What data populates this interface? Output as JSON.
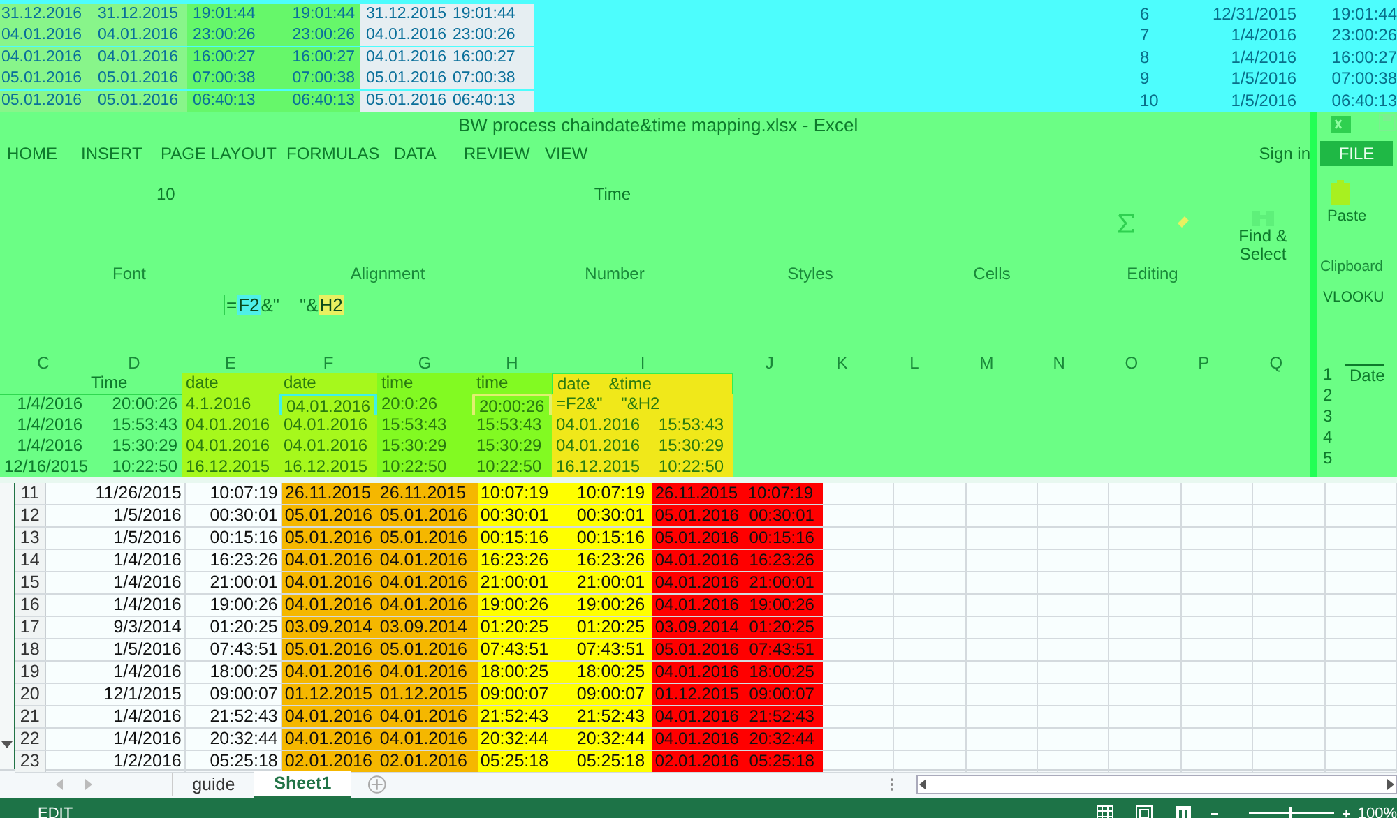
{
  "top_fragment": {
    "rows": [
      [
        "31.12.2016",
        "31.12.2015",
        "19:01:44",
        "19:01:44",
        "31.12.2015",
        "19:01:44"
      ],
      [
        "04.01.2016",
        "04.01.2016",
        "23:00:26",
        "23:00:26",
        "04.01.2016",
        "23:00:26"
      ],
      [
        "04.01.2016",
        "04.01.2016",
        "16:00:27",
        "16:00:27",
        "04.01.2016",
        "16:00:27"
      ],
      [
        "05.01.2016",
        "05.01.2016",
        "07:00:38",
        "07:00:38",
        "05.01.2016",
        "07:00:38"
      ],
      [
        "05.01.2016",
        "05.01.2016",
        "06:40:13",
        "06:40:13",
        "05.01.2016",
        "06:40:13"
      ]
    ]
  },
  "right_fragment": {
    "rows": [
      {
        "row": "6",
        "date": "12/31/2015",
        "time": "19:01:44"
      },
      {
        "row": "7",
        "date": "1/4/2016",
        "time": "23:00:26"
      },
      {
        "row": "8",
        "date": "1/4/2016",
        "time": "16:00:27"
      },
      {
        "row": "9",
        "date": "1/5/2016",
        "time": "07:00:38"
      },
      {
        "row": "10",
        "date": "1/5/2016",
        "time": "06:40:13"
      }
    ]
  },
  "window": {
    "title": "BW process chaindate&time mapping.xlsx - Excel"
  },
  "ribbon": {
    "tabs": [
      {
        "label": "HOME",
        "selected": false
      },
      {
        "label": "INSERT",
        "selected": false
      },
      {
        "label": "PAGE LAYOUT",
        "selected": false
      },
      {
        "label": "FORMULAS",
        "selected": false
      },
      {
        "label": "DATA",
        "selected": false
      },
      {
        "label": "REVIEW",
        "selected": false
      },
      {
        "label": "VIEW",
        "selected": false
      }
    ],
    "sign_in": "Sign in",
    "font_size": "10",
    "number_format": "Time",
    "find_select": "Find & Select",
    "group_labels": [
      "Font",
      "Alignment",
      "Number",
      "Styles",
      "Cells",
      "Editing"
    ]
  },
  "formula_bar": {
    "parts": [
      {
        "text": "=",
        "kind": "plain"
      },
      {
        "text": "F2",
        "kind": "ref",
        "color": "#4ff0e8"
      },
      {
        "text": "&\"    \"&",
        "kind": "plain"
      },
      {
        "text": "H2",
        "kind": "ref",
        "color": "#e8f060"
      }
    ]
  },
  "sheet": {
    "columns": [
      "C",
      "D",
      "E",
      "F",
      "G",
      "H",
      "I",
      "J",
      "K",
      "L",
      "M",
      "N",
      "O",
      "P",
      "Q"
    ],
    "rows": [
      [
        "",
        "Time",
        "date",
        "date",
        "time",
        "time",
        "date &time"
      ],
      [
        "1/4/2016",
        "20:00:26",
        "4.1.2016",
        {
          "text": "04.01.2016",
          "color": "#40f0e8"
        },
        "20:0:26",
        {
          "text": "20:00:26",
          "color": "#e0f070"
        },
        "=F2&\"    \"&H2"
      ],
      [
        "1/4/2016",
        "15:53:43",
        "04.01.2016",
        "04.01.2016",
        "15:53:43",
        "15:53:43",
        "04.01.2016 15:53:43"
      ],
      [
        "1/4/2016",
        "15:30:29",
        "04.01.2016",
        "04.01.2016",
        "15:30:29",
        "15:30:29",
        "04.01.2016 15:30:29"
      ],
      [
        "12/16/2015",
        "10:22:50",
        "16.12.2015",
        "16.12.2015",
        "10:22:50",
        "10:22:50",
        "16.12.2015 10:22:50"
      ]
    ]
  },
  "side_panel": {
    "file_tab": "FILE",
    "paste": "Paste",
    "clipboard": "Clipboard",
    "name_box": "VLOOKU",
    "rows": [
      {
        "row": "1",
        "value": "Date"
      },
      {
        "row": "2"
      },
      {
        "row": "3"
      },
      {
        "row": "4"
      },
      {
        "row": "5"
      }
    ]
  },
  "lower_sheet": {
    "rows": [
      {
        "row": "11",
        "cells": [
          "11/26/2015",
          "10:07:19",
          "26.11.2015",
          "26.11.2015",
          "10:07:19",
          "10:07:19",
          "26.11.2015 10:07:19"
        ]
      },
      {
        "row": "12",
        "cells": [
          "1/5/2016",
          "00:30:01",
          "05.01.2016",
          "05.01.2016",
          "00:30:01",
          "00:30:01",
          "05.01.2016 00:30:01"
        ]
      },
      {
        "row": "13",
        "cells": [
          "1/5/2016",
          "00:15:16",
          "05.01.2016",
          "05.01.2016",
          "00:15:16",
          "00:15:16",
          "05.01.2016 00:15:16"
        ]
      },
      {
        "row": "14",
        "cells": [
          "1/4/2016",
          "16:23:26",
          "04.01.2016",
          "04.01.2016",
          "16:23:26",
          "16:23:26",
          "04.01.2016 16:23:26"
        ]
      },
      {
        "row": "15",
        "cells": [
          "1/4/2016",
          "21:00:01",
          "04.01.2016",
          "04.01.2016",
          "21:00:01",
          "21:00:01",
          "04.01.2016 21:00:01"
        ]
      },
      {
        "row": "16",
        "cells": [
          "1/4/2016",
          "19:00:26",
          "04.01.2016",
          "04.01.2016",
          "19:00:26",
          "19:00:26",
          "04.01.2016 19:00:26"
        ]
      },
      {
        "row": "17",
        "cells": [
          "9/3/2014",
          "01:20:25",
          "03.09.2014",
          "03.09.2014",
          "01:20:25",
          "01:20:25",
          "03.09.2014 01:20:25"
        ]
      },
      {
        "row": "18",
        "cells": [
          "1/5/2016",
          "07:43:51",
          "05.01.2016",
          "05.01.2016",
          "07:43:51",
          "07:43:51",
          "05.01.2016 07:43:51"
        ]
      },
      {
        "row": "19",
        "cells": [
          "1/4/2016",
          "18:00:25",
          "04.01.2016",
          "04.01.2016",
          "18:00:25",
          "18:00:25",
          "04.01.2016 18:00:25"
        ]
      },
      {
        "row": "20",
        "cells": [
          "12/1/2015",
          "09:00:07",
          "01.12.2015",
          "01.12.2015",
          "09:00:07",
          "09:00:07",
          "01.12.2015 09:00:07"
        ]
      },
      {
        "row": "21",
        "cells": [
          "1/4/2016",
          "21:52:43",
          "04.01.2016",
          "04.01.2016",
          "21:52:43",
          "21:52:43",
          "04.01.2016 21:52:43"
        ]
      },
      {
        "row": "22",
        "cells": [
          "1/4/2016",
          "20:32:44",
          "04.01.2016",
          "04.01.2016",
          "20:32:44",
          "20:32:44",
          "04.01.2016 20:32:44"
        ]
      },
      {
        "row": "23",
        "cells": [
          "1/2/2016",
          "05:25:18",
          "02.01.2016",
          "02.01.2016",
          "05:25:18",
          "05:25:18",
          "02.01.2016 05:25:18"
        ]
      }
    ]
  },
  "sheet_tabs": [
    {
      "label": "guide",
      "selected": false
    },
    {
      "label": "Sheet1",
      "selected": true
    }
  ],
  "status_bar": {
    "mode": "EDIT",
    "zoom": "100%",
    "zoom_slider": {
      "level": 0.5
    }
  }
}
